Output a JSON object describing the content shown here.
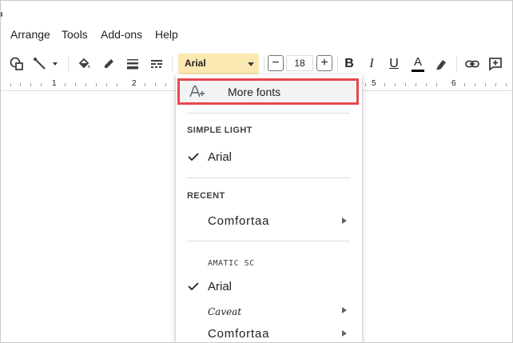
{
  "menubar": {
    "items": [
      "Arrange",
      "Tools",
      "Add-ons",
      "Help"
    ]
  },
  "toolbar": {
    "icons": [
      "shape-icon",
      "line-icon",
      "fill-color-icon",
      "border-color-icon",
      "border-weight-icon",
      "border-dash-icon"
    ],
    "font_name": "Arial",
    "font_size": "18",
    "minus": "−",
    "plus": "+",
    "bold": "B",
    "italic": "I",
    "underline": "U",
    "text_color": "A"
  },
  "ruler": {
    "numbers": [
      "1",
      "2",
      "5",
      "6"
    ]
  },
  "dropdown": {
    "more_fonts": "More fonts",
    "sections": [
      {
        "title": "SIMPLE LIGHT",
        "items": [
          {
            "label": "Arial",
            "checked": true,
            "submenu": false
          }
        ]
      },
      {
        "title": "RECENT",
        "items": [
          {
            "label": "Comfortaa",
            "checked": false,
            "submenu": true
          }
        ]
      },
      {
        "title": "",
        "items": [
          {
            "label": "AMATIC SC",
            "checked": false,
            "submenu": false
          },
          {
            "label": "Arial",
            "checked": true,
            "submenu": false
          },
          {
            "label": "Caveat",
            "checked": false,
            "submenu": true
          },
          {
            "label": "Comfortaa",
            "checked": false,
            "submenu": true
          }
        ]
      }
    ]
  },
  "colors": {
    "font_box_bg": "#fce8b2",
    "highlight_border": "#e8474e",
    "hover_bg": "#f1f3f4"
  }
}
